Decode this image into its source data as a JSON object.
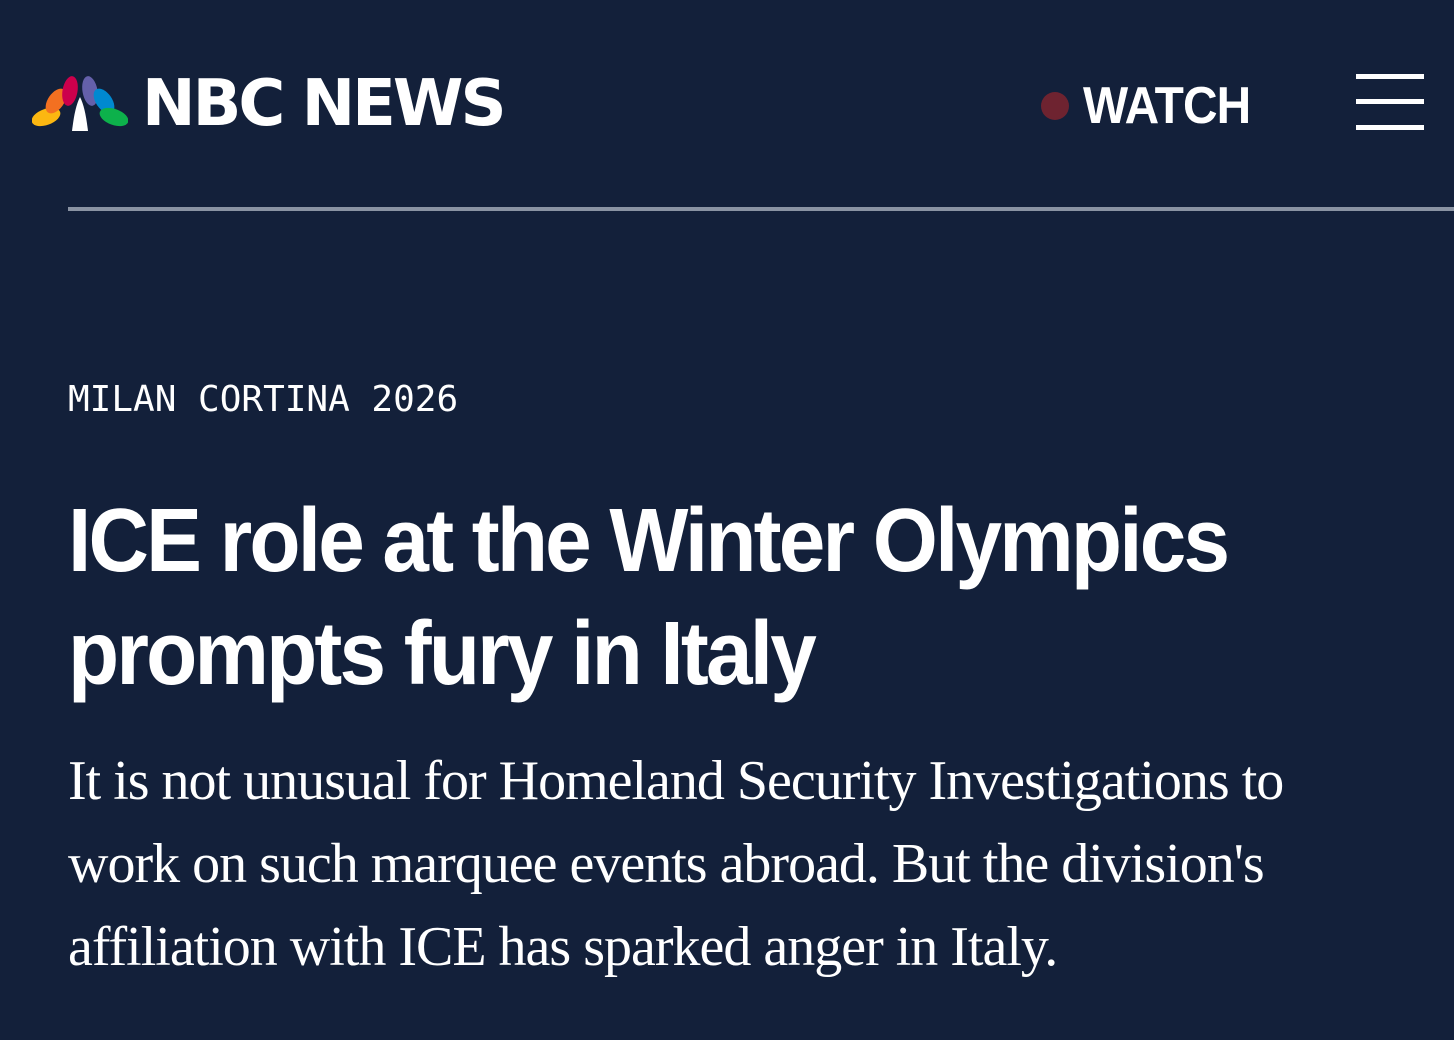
{
  "header": {
    "logo_text": "NBC NEWS",
    "watch_label": "WATCH",
    "logo_icon": "nbc-peacock-icon",
    "menu_icon": "hamburger-menu-icon"
  },
  "article": {
    "eyebrow": "MILAN CORTINA 2026",
    "headline_line1": "ICE role at the Winter Olympics",
    "headline_line2": "prompts fury in Italy",
    "dek": "It is not unusual for Homeland Security Investigations to work on such marquee events abroad. But the division's affiliation with ICE has sparked anger in Italy."
  },
  "colors": {
    "background": "#13203a",
    "text": "#ffffff",
    "live_dot": "#6e2330",
    "divider": "#8a93a3",
    "peacock": [
      "#fcb711",
      "#f37021",
      "#cc004c",
      "#6460aa",
      "#0089d0",
      "#0db14b"
    ]
  }
}
